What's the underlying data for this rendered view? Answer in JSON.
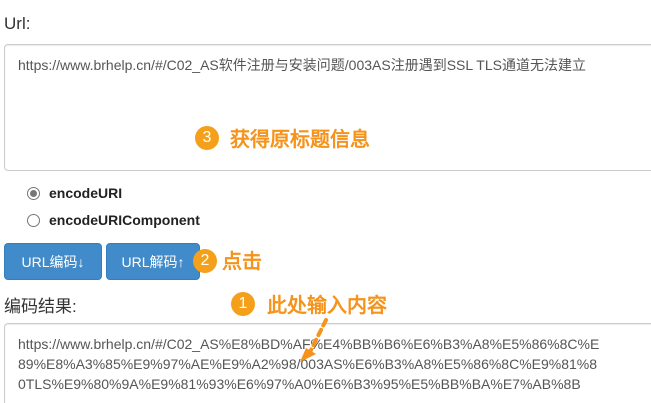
{
  "url_label": "Url:",
  "url_input_value": "https://www.brhelp.cn/#/C02_AS软件注册与安装问题/003AS注册遇到SSL TLS通道无法建立",
  "radios": [
    {
      "label": "encodeURI",
      "checked": true
    },
    {
      "label": "encodeURIComponent",
      "checked": false
    }
  ],
  "buttons": {
    "encode_label": "URL编码↓",
    "decode_label": "URL解码↑"
  },
  "result_label": "编码结果:",
  "result_value": "https://www.brhelp.cn/#/C02_AS%E8%BD%AF%E4%BB%B6%E6%B3%A8%E5%86%8C%E\n89%E8%A3%85%E9%97%AE%E9%A2%98/003AS%E6%B3%A8%E5%86%8C%E9%81%8\n0TLS%E9%80%9A%E9%81%93%E6%97%A0%E6%B3%95%E5%BB%BA%E7%AB%8B",
  "annotations": {
    "step1": {
      "number": "1",
      "text": "此处输入内容"
    },
    "step2": {
      "number": "2",
      "text": "点击"
    },
    "step3": {
      "number": "3",
      "text": "获得原标题信息"
    }
  },
  "colors": {
    "annotation": "#f5931a",
    "button": "#428bca"
  }
}
